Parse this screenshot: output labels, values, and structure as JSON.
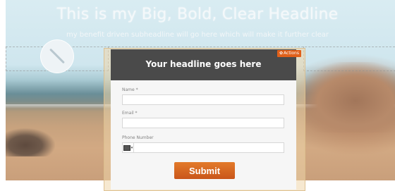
{
  "hero": {
    "headline": "This is my Big, Bold, Clear Headline",
    "subheadline": "my benefit driven subheadline will go here which will make it further clear"
  },
  "form": {
    "title": "Your headline goes here",
    "actions_label": "Actions",
    "fields": [
      {
        "label": "Name *",
        "value": ""
      },
      {
        "label": "Email *",
        "value": ""
      },
      {
        "label": "Phone Number",
        "value": ""
      }
    ],
    "submit_label": "Submit"
  },
  "colors": {
    "modal_header": "#4a4a4a",
    "submit_button": "#d8641e",
    "actions_badge": "#e0601a"
  },
  "icons": [
    "gear-icon",
    "flag-icon",
    "chevron-down-icon"
  ]
}
